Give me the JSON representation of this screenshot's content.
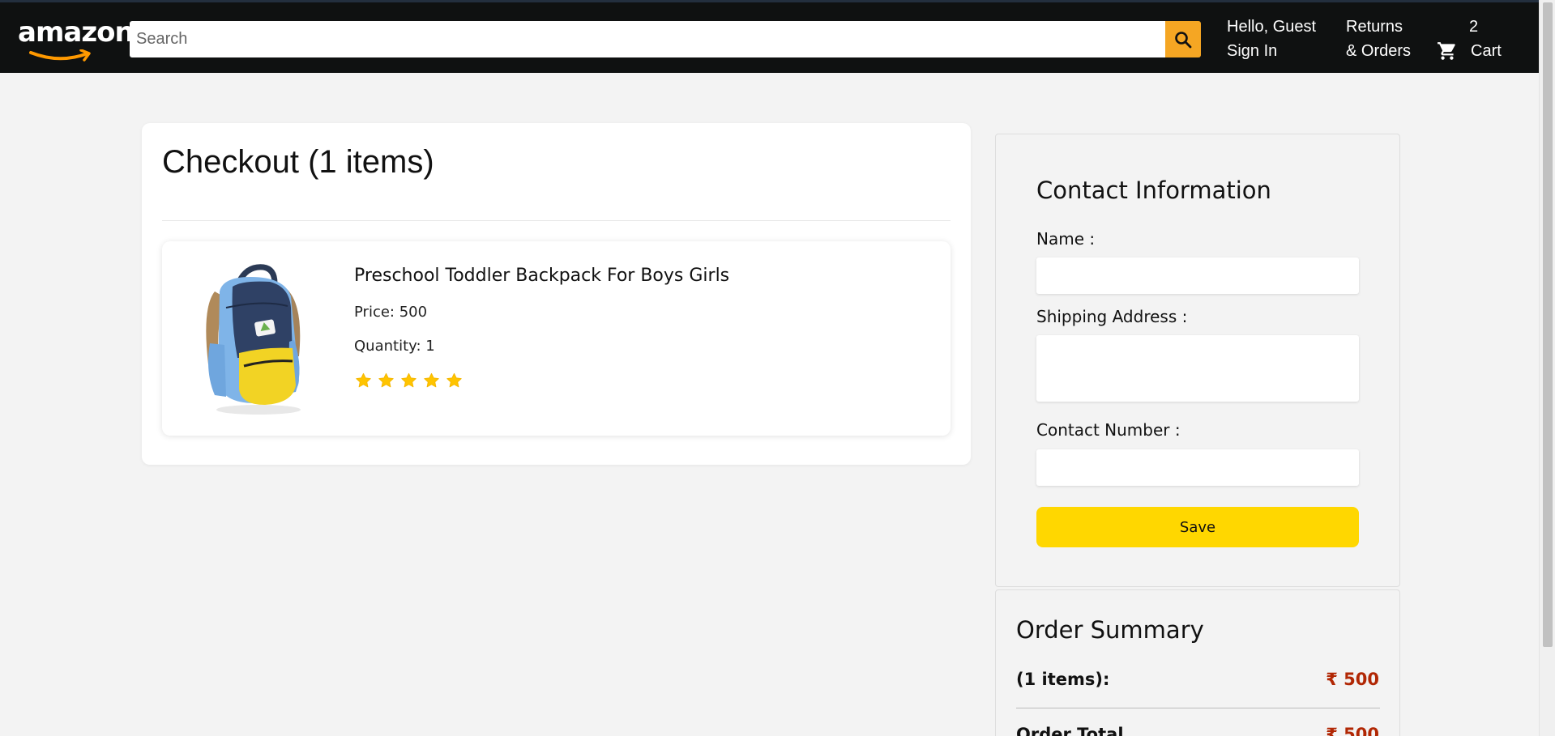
{
  "header": {
    "logo_text": "amazon",
    "search": {
      "placeholder": "Search",
      "value": ""
    },
    "greeting_line1": "Hello, Guest",
    "greeting_line2": "Sign In",
    "orders_line1": "Returns",
    "orders_line2": "& Orders",
    "cart_count": "2",
    "cart_label": "Cart"
  },
  "checkout": {
    "title": "Checkout (1 items)",
    "items": [
      {
        "title": "Preschool Toddler Backpack For Boys Girls",
        "price": "Price: 500",
        "quantity": "Quantity: 1",
        "rating": 5
      }
    ]
  },
  "contact": {
    "title": "Contact Information",
    "name_label": "Name :",
    "name_value": "",
    "address_label": "Shipping Address :",
    "address_value": "",
    "phone_label": "Contact Number :",
    "phone_value": "",
    "save_label": "Save"
  },
  "summary": {
    "title": "Order Summary",
    "items_label": "(1 items):",
    "items_amount": "₹ 500",
    "total_label": "Order Total",
    "total_amount": "₹ 500"
  },
  "colors": {
    "header_bg": "#0f1111",
    "search_button": "#f5a623",
    "save_button": "#ffd700",
    "price_red": "#b12704",
    "star": "#ffc400"
  }
}
